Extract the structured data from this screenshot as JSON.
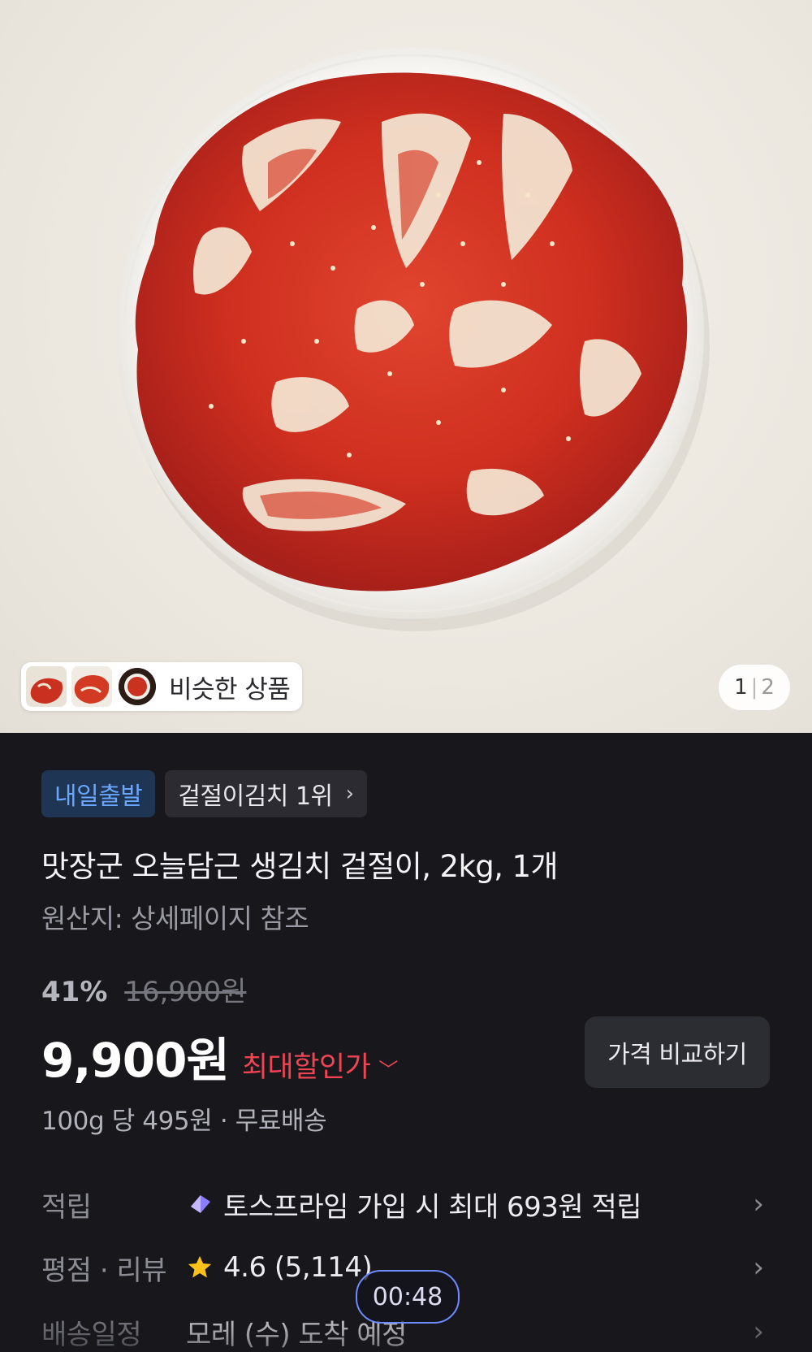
{
  "gallery": {
    "similar_label": "비슷한 상품",
    "page_current": "1",
    "page_total": "2"
  },
  "badges": {
    "delivery": "내일출발",
    "ranking": "겉절이김치 1위"
  },
  "product": {
    "title": "맛장군 오늘담근 생김치 겉절이, 2kg, 1개",
    "origin": "원산지: 상세페이지 참조",
    "discount_rate": "41%",
    "original_price": "16,900원",
    "price": "9,900원",
    "max_discount_label": "최대할인가",
    "compare_button": "가격 비교하기",
    "unit_price": "100g 당 495원 · 무료배송"
  },
  "info_rows": [
    {
      "label": "적립",
      "value": "토스프라임 가입 시 최대 693원 적립",
      "icon": "toss-prime-icon"
    },
    {
      "label": "평점 · 리뷰",
      "value": "4.6 (5,114)",
      "icon": "star-icon"
    },
    {
      "label": "배송일정",
      "value": "모레 (수) 도착 예정"
    }
  ],
  "overlay": {
    "timer": "00:48"
  },
  "colors": {
    "background": "#17171c",
    "accent_blue": "#6aa6ff",
    "discount_red": "#f04452",
    "star": "#ffc21a"
  }
}
